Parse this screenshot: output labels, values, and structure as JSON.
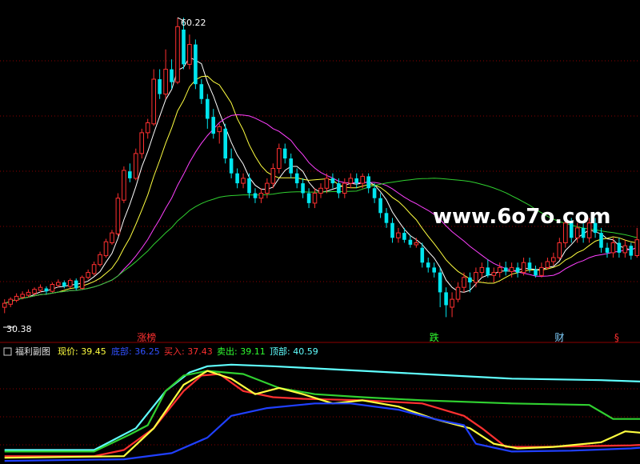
{
  "chart_data": [
    {
      "type": "candlestick",
      "price_high_label": "60.22",
      "price_low_label": "30.38",
      "watermark": "www.6o7o.com",
      "events": [
        {
          "label": "涨榜",
          "color": "#ff3030",
          "index": 23
        },
        {
          "label": "跌",
          "color": "#30ff30",
          "index": 72
        },
        {
          "label": "财",
          "color": "#80d0ff",
          "index": 93
        },
        {
          "label": "§",
          "color": "#ff3030",
          "index": 103
        }
      ],
      "ylim": [
        28.5,
        61.5
      ],
      "colors": {
        "up": "#ff3030",
        "down": "#00e5ee",
        "ma1": "#ffffff",
        "ma2": "#ffff40",
        "ma3": "#ff40ff",
        "ma4": "#30d030"
      },
      "candles": [
        [
          31.0,
          31.4,
          30.4,
          31.8
        ],
        [
          31.3,
          31.8,
          31.0,
          32.0
        ],
        [
          31.7,
          32.1,
          31.5,
          32.4
        ],
        [
          32.0,
          32.3,
          31.8,
          32.6
        ],
        [
          32.2,
          32.5,
          32.0,
          32.8
        ],
        [
          32.4,
          32.8,
          32.2,
          33.0
        ],
        [
          32.7,
          33.0,
          32.5,
          33.3
        ],
        [
          32.9,
          32.6,
          32.3,
          33.1
        ],
        [
          32.6,
          33.3,
          32.5,
          33.5
        ],
        [
          33.2,
          33.5,
          33.0,
          33.8
        ],
        [
          33.5,
          33.1,
          32.9,
          33.7
        ],
        [
          33.1,
          33.7,
          32.9,
          33.9
        ],
        [
          33.7,
          32.9,
          32.7,
          33.9
        ],
        [
          32.9,
          34.0,
          32.8,
          34.2
        ],
        [
          34.0,
          34.5,
          33.8,
          34.8
        ],
        [
          34.4,
          35.3,
          34.2,
          35.6
        ],
        [
          35.3,
          36.3,
          35.1,
          36.6
        ],
        [
          36.2,
          37.6,
          36.0,
          37.9
        ],
        [
          37.5,
          38.5,
          37.3,
          38.8
        ],
        [
          38.4,
          42.0,
          38.2,
          42.5
        ],
        [
          41.8,
          44.8,
          41.5,
          45.2
        ],
        [
          44.7,
          44.0,
          43.6,
          45.5
        ],
        [
          44.0,
          46.5,
          43.8,
          47.0
        ],
        [
          46.5,
          48.6,
          46.0,
          49.0
        ],
        [
          48.6,
          49.6,
          48.0,
          50.0
        ],
        [
          49.5,
          54.0,
          49.3,
          55.0
        ],
        [
          54.0,
          52.5,
          52.0,
          55.0
        ],
        [
          52.5,
          55.0,
          52.0,
          57.0
        ],
        [
          55.0,
          53.7,
          53.0,
          56.0
        ],
        [
          53.7,
          59.3,
          53.5,
          60.2
        ],
        [
          59.0,
          55.5,
          55.0,
          60.2
        ],
        [
          55.5,
          57.5,
          55.0,
          58.5
        ],
        [
          57.5,
          53.5,
          53.0,
          58.0
        ],
        [
          53.5,
          52.0,
          51.5,
          54.0
        ],
        [
          52.0,
          50.0,
          49.0,
          52.5
        ],
        [
          50.2,
          48.5,
          48.0,
          51.0
        ],
        [
          48.7,
          49.2,
          47.5,
          49.5
        ],
        [
          49.0,
          46.0,
          45.5,
          49.5
        ],
        [
          46.0,
          44.5,
          44.0,
          47.0
        ],
        [
          44.5,
          43.5,
          43.0,
          45.0
        ],
        [
          43.5,
          44.0,
          43.0,
          44.5
        ],
        [
          44.0,
          42.5,
          42.0,
          44.5
        ],
        [
          42.5,
          42.0,
          41.5,
          43.0
        ],
        [
          42.0,
          42.5,
          41.5,
          43.0
        ],
        [
          42.5,
          43.5,
          42.0,
          44.0
        ],
        [
          43.5,
          45.0,
          43.0,
          45.5
        ],
        [
          45.0,
          47.0,
          44.5,
          47.5
        ],
        [
          47.0,
          46.0,
          45.5,
          47.5
        ],
        [
          46.0,
          44.5,
          44.0,
          46.5
        ],
        [
          44.5,
          43.5,
          43.0,
          45.0
        ],
        [
          43.5,
          42.5,
          42.0,
          44.0
        ],
        [
          42.5,
          41.5,
          41.0,
          43.0
        ],
        [
          41.5,
          42.5,
          41.0,
          43.0
        ],
        [
          42.5,
          43.0,
          42.0,
          43.5
        ],
        [
          43.0,
          44.0,
          42.5,
          44.5
        ],
        [
          44.0,
          43.5,
          43.0,
          44.5
        ],
        [
          43.5,
          42.5,
          42.0,
          44.0
        ],
        [
          42.5,
          43.5,
          42.0,
          44.0
        ],
        [
          43.5,
          44.0,
          43.0,
          44.5
        ],
        [
          44.0,
          43.5,
          43.0,
          44.5
        ],
        [
          43.5,
          44.2,
          43.0,
          44.5
        ],
        [
          44.2,
          43.0,
          42.5,
          44.5
        ],
        [
          43.0,
          42.0,
          41.5,
          43.5
        ],
        [
          42.0,
          40.5,
          40.0,
          42.5
        ],
        [
          40.5,
          39.5,
          39.0,
          41.0
        ],
        [
          39.5,
          38.0,
          37.5,
          40.0
        ],
        [
          38.0,
          38.5,
          37.5,
          39.0
        ],
        [
          38.5,
          37.8,
          37.5,
          39.0
        ],
        [
          37.8,
          37.3,
          37.0,
          38.2
        ],
        [
          37.3,
          37.5,
          37.0,
          38.0
        ],
        [
          37.0,
          35.5,
          35.0,
          37.5
        ],
        [
          35.5,
          35.0,
          34.5,
          36.0
        ],
        [
          35.0,
          34.5,
          34.0,
          35.5
        ],
        [
          34.5,
          32.5,
          31.0,
          35.0
        ],
        [
          32.5,
          31.2,
          30.0,
          33.0
        ],
        [
          31.0,
          31.8,
          30.0,
          32.5
        ],
        [
          31.8,
          33.0,
          31.5,
          33.5
        ],
        [
          33.0,
          34.0,
          32.5,
          34.5
        ],
        [
          34.0,
          33.5,
          32.5,
          34.5
        ],
        [
          33.5,
          34.5,
          33.0,
          35.0
        ],
        [
          34.5,
          35.0,
          34.0,
          35.5
        ],
        [
          35.0,
          34.2,
          34.0,
          35.8
        ],
        [
          34.2,
          34.5,
          33.5,
          35.0
        ],
        [
          34.5,
          35.0,
          34.0,
          35.5
        ],
        [
          35.0,
          34.6,
          34.2,
          35.6
        ],
        [
          34.6,
          35.0,
          34.0,
          35.5
        ],
        [
          35.0,
          34.5,
          34.0,
          35.5
        ],
        [
          34.5,
          35.5,
          34.2,
          36.0
        ],
        [
          35.5,
          34.8,
          34.5,
          36.0
        ],
        [
          34.8,
          34.2,
          34.0,
          35.2
        ],
        [
          34.2,
          35.0,
          34.0,
          35.5
        ],
        [
          35.0,
          35.6,
          34.8,
          36.0
        ],
        [
          35.6,
          36.0,
          35.2,
          36.5
        ],
        [
          36.0,
          37.5,
          35.8,
          38.0
        ],
        [
          37.5,
          39.5,
          37.0,
          40.0
        ],
        [
          39.5,
          38.0,
          37.5,
          40.0
        ],
        [
          38.0,
          39.0,
          37.5,
          39.5
        ],
        [
          39.0,
          38.0,
          37.5,
          39.5
        ],
        [
          38.0,
          39.5,
          37.5,
          40.0
        ],
        [
          39.5,
          38.5,
          38.0,
          40.0
        ],
        [
          38.5,
          37.0,
          36.5,
          39.0
        ],
        [
          37.0,
          36.5,
          36.0,
          37.5
        ],
        [
          36.5,
          37.5,
          36.0,
          38.0
        ],
        [
          37.5,
          36.5,
          36.0,
          38.0
        ],
        [
          36.5,
          37.2,
          36.0,
          37.8
        ],
        [
          37.2,
          36.2,
          35.8,
          37.5
        ],
        [
          36.2,
          37.8,
          36.0,
          39.0
        ]
      ]
    },
    {
      "type": "line",
      "indicator_name": "福利副图",
      "legend": [
        {
          "label": "现价: 39.45",
          "color": "#ffff40"
        },
        {
          "label": "底部: 36.25",
          "color": "#3050ff"
        },
        {
          "label": "买入: 37.43",
          "color": "#ff3030"
        },
        {
          "label": "卖出: 39.11",
          "color": "#30ff30"
        },
        {
          "label": "顶部: 40.59",
          "color": "#60ffff"
        }
      ],
      "ylim": [
        29,
        62
      ],
      "series": [
        {
          "color": "#60ffff",
          "points": [
            [
              0,
              33
            ],
            [
              15,
              33
            ],
            [
              22,
              40
            ],
            [
              27,
              52
            ],
            [
              31,
              58
            ],
            [
              34,
              60
            ],
            [
              38,
              60.5
            ],
            [
              45,
              60
            ],
            [
              55,
              59
            ],
            [
              70,
              57.5
            ],
            [
              85,
              56
            ],
            [
              100,
              55.5
            ],
            [
              115,
              54.5
            ],
            [
              120,
              54.3
            ]
          ]
        },
        {
          "color": "#30d030",
          "points": [
            [
              0,
              32.5
            ],
            [
              15,
              32.5
            ],
            [
              21,
              38
            ],
            [
              24,
              41
            ],
            [
              27,
              52
            ],
            [
              30,
              57
            ],
            [
              34,
              58.5
            ],
            [
              40,
              57.5
            ],
            [
              46,
              53
            ],
            [
              52,
              51
            ],
            [
              60,
              50
            ],
            [
              70,
              49
            ],
            [
              85,
              48
            ],
            [
              98,
              47.5
            ],
            [
              102,
              43
            ],
            [
              110,
              43
            ],
            [
              120,
              42.5
            ]
          ]
        },
        {
          "color": "#ff3030",
          "points": [
            [
              0,
              31
            ],
            [
              15,
              31
            ],
            [
              20,
              33
            ],
            [
              25,
              40
            ],
            [
              30,
              52
            ],
            [
              33,
              57
            ],
            [
              36,
              57.5
            ],
            [
              40,
              52
            ],
            [
              45,
              50
            ],
            [
              50,
              49.5
            ],
            [
              60,
              49
            ],
            [
              70,
              48
            ],
            [
              77,
              44
            ],
            [
              80,
              40
            ],
            [
              84,
              34
            ],
            [
              90,
              34
            ],
            [
              105,
              34.5
            ],
            [
              115,
              35.5
            ],
            [
              120,
              37
            ]
          ]
        },
        {
          "color": "#ffff40",
          "points": [
            [
              0,
              30.5
            ],
            [
              20,
              31
            ],
            [
              25,
              40
            ],
            [
              30,
              54
            ],
            [
              34,
              58.5
            ],
            [
              38,
              56
            ],
            [
              42,
              51
            ],
            [
              46,
              53
            ],
            [
              50,
              51
            ],
            [
              55,
              48
            ],
            [
              60,
              49
            ],
            [
              66,
              47
            ],
            [
              72,
              43
            ],
            [
              78,
              40
            ],
            [
              82,
              35
            ],
            [
              86,
              33.5
            ],
            [
              92,
              34
            ],
            [
              100,
              35.5
            ],
            [
              104,
              39
            ],
            [
              110,
              38
            ],
            [
              118,
              37
            ],
            [
              120,
              37.5
            ]
          ]
        },
        {
          "color": "#2040ff",
          "points": [
            [
              0,
              29.5
            ],
            [
              20,
              30
            ],
            [
              28,
              32
            ],
            [
              34,
              37
            ],
            [
              38,
              44
            ],
            [
              44,
              46.5
            ],
            [
              52,
              48
            ],
            [
              58,
              48
            ],
            [
              66,
              46
            ],
            [
              72,
              43
            ],
            [
              77,
              41
            ],
            [
              79,
              35
            ],
            [
              85,
              32.5
            ],
            [
              95,
              32.8
            ],
            [
              105,
              33.5
            ],
            [
              115,
              35
            ],
            [
              120,
              35.5
            ]
          ]
        }
      ]
    }
  ]
}
